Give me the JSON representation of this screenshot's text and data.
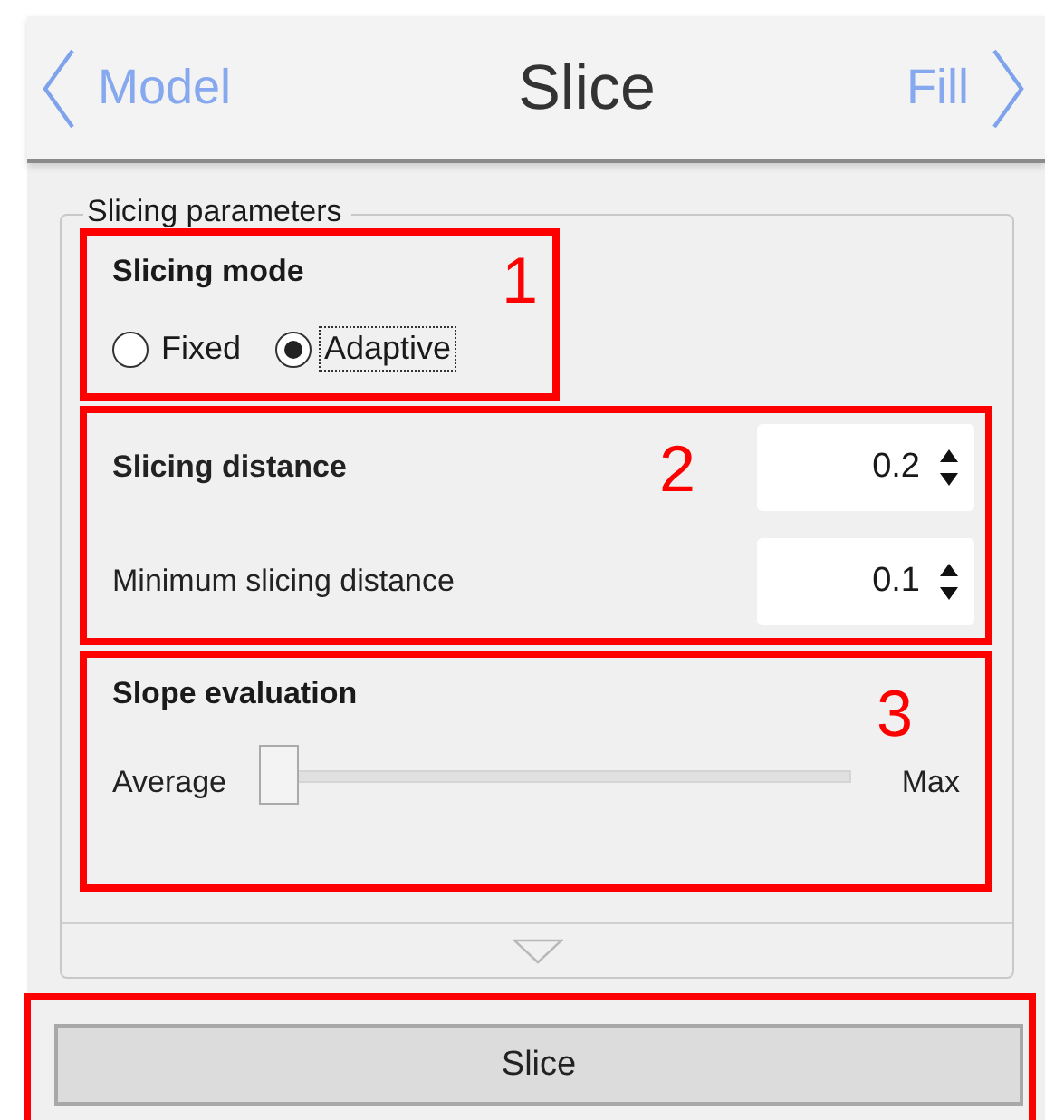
{
  "header": {
    "back": {
      "label": "Model"
    },
    "title": "Slice",
    "forward": {
      "label": "Fill"
    }
  },
  "group": {
    "title": "Slicing parameters",
    "sections": [
      {
        "kind": "radio",
        "heading": "Slicing mode",
        "callout": "1",
        "options": [
          {
            "label": "Fixed",
            "selected": false,
            "focused": false
          },
          {
            "label": "Adaptive",
            "selected": true,
            "focused": true
          }
        ]
      },
      {
        "kind": "spin",
        "callout": "2",
        "rows": [
          {
            "label": "Slicing distance",
            "bold": true,
            "value": "0.2"
          },
          {
            "label": "Minimum slicing distance",
            "bold": false,
            "value": "0.1"
          }
        ]
      },
      {
        "kind": "slider",
        "heading": "Slope evaluation",
        "callout": "3",
        "min_label": "Average",
        "max_label": "Max",
        "level": 0
      }
    ]
  },
  "action": {
    "label": "Slice"
  }
}
